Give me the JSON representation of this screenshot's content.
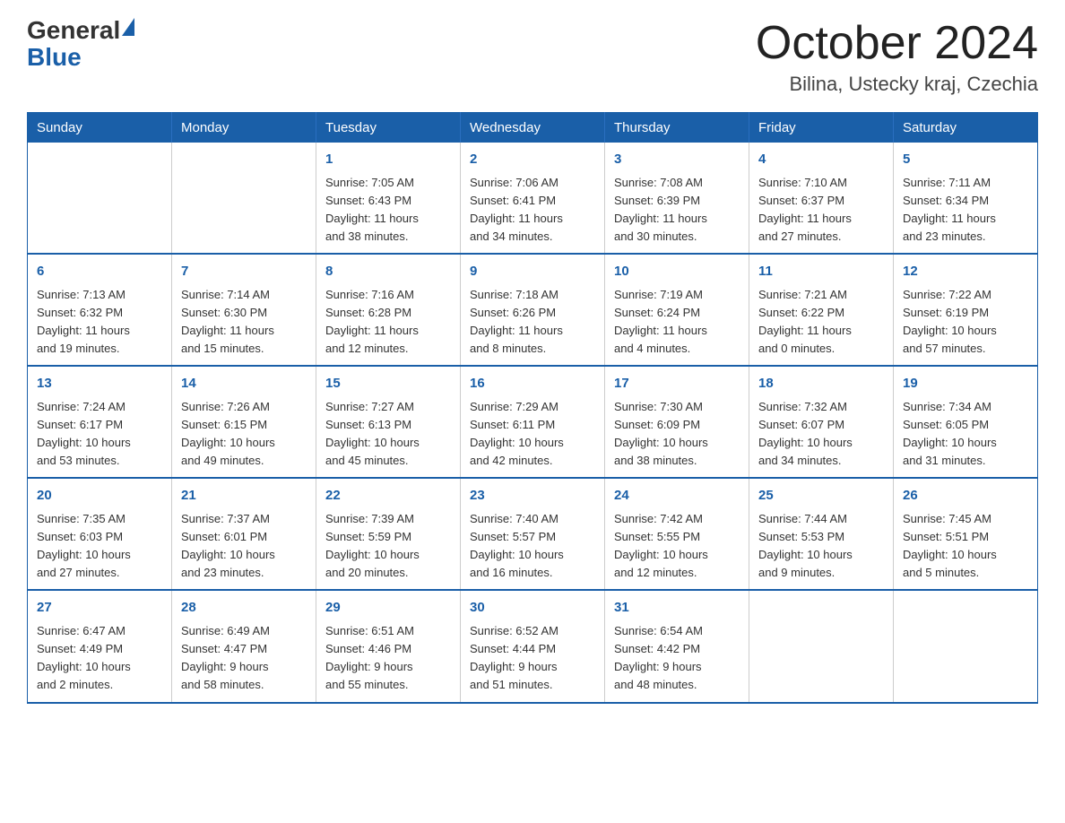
{
  "header": {
    "logo_general": "General",
    "logo_blue": "Blue",
    "month_title": "October 2024",
    "location": "Bilina, Ustecky kraj, Czechia"
  },
  "calendar": {
    "days_of_week": [
      "Sunday",
      "Monday",
      "Tuesday",
      "Wednesday",
      "Thursday",
      "Friday",
      "Saturday"
    ],
    "weeks": [
      [
        {
          "day": "",
          "info": ""
        },
        {
          "day": "",
          "info": ""
        },
        {
          "day": "1",
          "info": "Sunrise: 7:05 AM\nSunset: 6:43 PM\nDaylight: 11 hours\nand 38 minutes."
        },
        {
          "day": "2",
          "info": "Sunrise: 7:06 AM\nSunset: 6:41 PM\nDaylight: 11 hours\nand 34 minutes."
        },
        {
          "day": "3",
          "info": "Sunrise: 7:08 AM\nSunset: 6:39 PM\nDaylight: 11 hours\nand 30 minutes."
        },
        {
          "day": "4",
          "info": "Sunrise: 7:10 AM\nSunset: 6:37 PM\nDaylight: 11 hours\nand 27 minutes."
        },
        {
          "day": "5",
          "info": "Sunrise: 7:11 AM\nSunset: 6:34 PM\nDaylight: 11 hours\nand 23 minutes."
        }
      ],
      [
        {
          "day": "6",
          "info": "Sunrise: 7:13 AM\nSunset: 6:32 PM\nDaylight: 11 hours\nand 19 minutes."
        },
        {
          "day": "7",
          "info": "Sunrise: 7:14 AM\nSunset: 6:30 PM\nDaylight: 11 hours\nand 15 minutes."
        },
        {
          "day": "8",
          "info": "Sunrise: 7:16 AM\nSunset: 6:28 PM\nDaylight: 11 hours\nand 12 minutes."
        },
        {
          "day": "9",
          "info": "Sunrise: 7:18 AM\nSunset: 6:26 PM\nDaylight: 11 hours\nand 8 minutes."
        },
        {
          "day": "10",
          "info": "Sunrise: 7:19 AM\nSunset: 6:24 PM\nDaylight: 11 hours\nand 4 minutes."
        },
        {
          "day": "11",
          "info": "Sunrise: 7:21 AM\nSunset: 6:22 PM\nDaylight: 11 hours\nand 0 minutes."
        },
        {
          "day": "12",
          "info": "Sunrise: 7:22 AM\nSunset: 6:19 PM\nDaylight: 10 hours\nand 57 minutes."
        }
      ],
      [
        {
          "day": "13",
          "info": "Sunrise: 7:24 AM\nSunset: 6:17 PM\nDaylight: 10 hours\nand 53 minutes."
        },
        {
          "day": "14",
          "info": "Sunrise: 7:26 AM\nSunset: 6:15 PM\nDaylight: 10 hours\nand 49 minutes."
        },
        {
          "day": "15",
          "info": "Sunrise: 7:27 AM\nSunset: 6:13 PM\nDaylight: 10 hours\nand 45 minutes."
        },
        {
          "day": "16",
          "info": "Sunrise: 7:29 AM\nSunset: 6:11 PM\nDaylight: 10 hours\nand 42 minutes."
        },
        {
          "day": "17",
          "info": "Sunrise: 7:30 AM\nSunset: 6:09 PM\nDaylight: 10 hours\nand 38 minutes."
        },
        {
          "day": "18",
          "info": "Sunrise: 7:32 AM\nSunset: 6:07 PM\nDaylight: 10 hours\nand 34 minutes."
        },
        {
          "day": "19",
          "info": "Sunrise: 7:34 AM\nSunset: 6:05 PM\nDaylight: 10 hours\nand 31 minutes."
        }
      ],
      [
        {
          "day": "20",
          "info": "Sunrise: 7:35 AM\nSunset: 6:03 PM\nDaylight: 10 hours\nand 27 minutes."
        },
        {
          "day": "21",
          "info": "Sunrise: 7:37 AM\nSunset: 6:01 PM\nDaylight: 10 hours\nand 23 minutes."
        },
        {
          "day": "22",
          "info": "Sunrise: 7:39 AM\nSunset: 5:59 PM\nDaylight: 10 hours\nand 20 minutes."
        },
        {
          "day": "23",
          "info": "Sunrise: 7:40 AM\nSunset: 5:57 PM\nDaylight: 10 hours\nand 16 minutes."
        },
        {
          "day": "24",
          "info": "Sunrise: 7:42 AM\nSunset: 5:55 PM\nDaylight: 10 hours\nand 12 minutes."
        },
        {
          "day": "25",
          "info": "Sunrise: 7:44 AM\nSunset: 5:53 PM\nDaylight: 10 hours\nand 9 minutes."
        },
        {
          "day": "26",
          "info": "Sunrise: 7:45 AM\nSunset: 5:51 PM\nDaylight: 10 hours\nand 5 minutes."
        }
      ],
      [
        {
          "day": "27",
          "info": "Sunrise: 6:47 AM\nSunset: 4:49 PM\nDaylight: 10 hours\nand 2 minutes."
        },
        {
          "day": "28",
          "info": "Sunrise: 6:49 AM\nSunset: 4:47 PM\nDaylight: 9 hours\nand 58 minutes."
        },
        {
          "day": "29",
          "info": "Sunrise: 6:51 AM\nSunset: 4:46 PM\nDaylight: 9 hours\nand 55 minutes."
        },
        {
          "day": "30",
          "info": "Sunrise: 6:52 AM\nSunset: 4:44 PM\nDaylight: 9 hours\nand 51 minutes."
        },
        {
          "day": "31",
          "info": "Sunrise: 6:54 AM\nSunset: 4:42 PM\nDaylight: 9 hours\nand 48 minutes."
        },
        {
          "day": "",
          "info": ""
        },
        {
          "day": "",
          "info": ""
        }
      ]
    ]
  }
}
